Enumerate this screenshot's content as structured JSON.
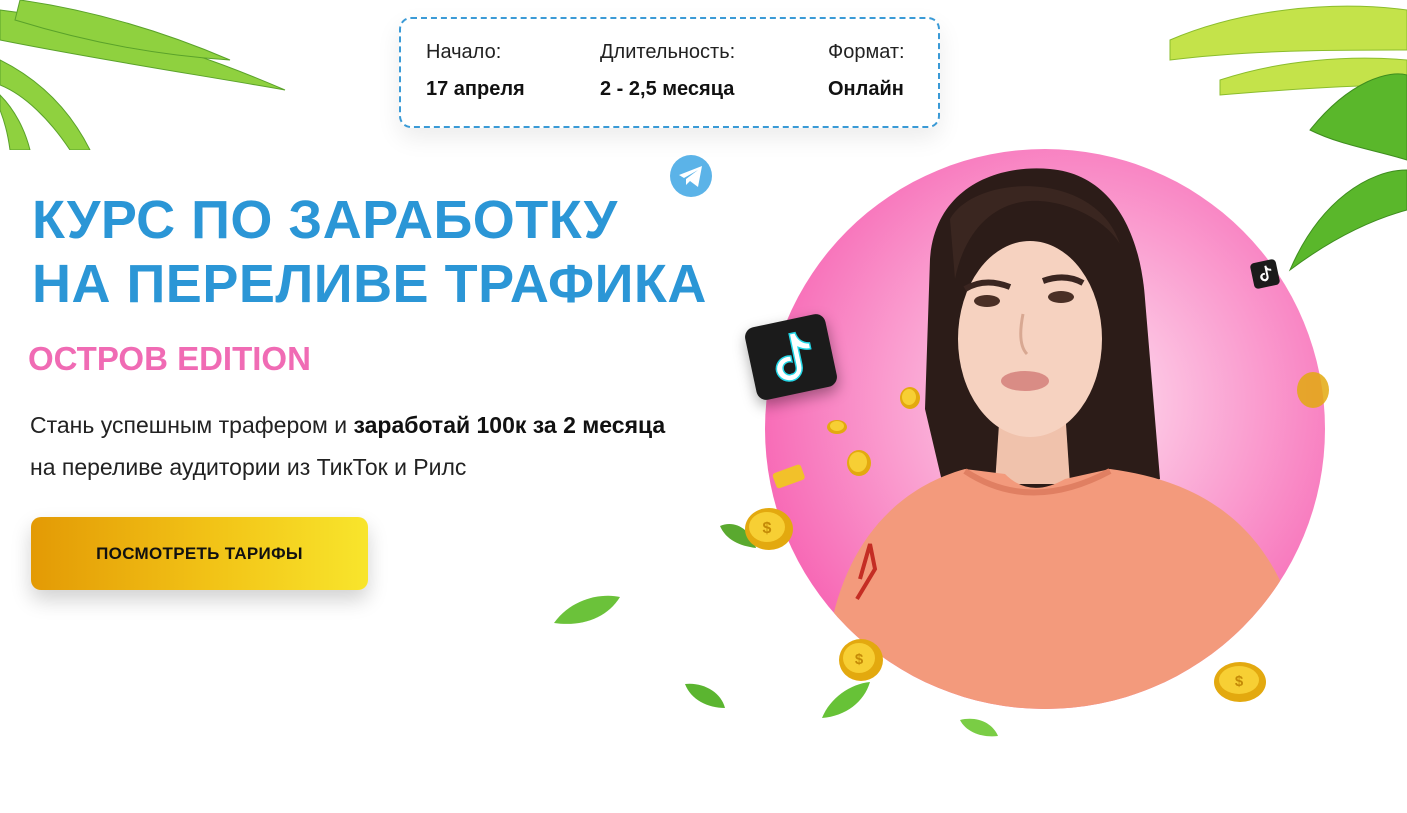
{
  "info": [
    {
      "label": "Начало:",
      "value": "17 апреля"
    },
    {
      "label": "Длительность:",
      "value": "2 - 2,5 месяца"
    },
    {
      "label": "Формат:",
      "value": "Онлайн"
    }
  ],
  "hero": {
    "title_line1": "КУРС ПО ЗАРАБОТКУ",
    "title_line2": "НА ПЕРЕЛИВЕ ТРАФИКА",
    "subtitle": "ОСТРОВ EDITION",
    "desc_part1": "Стань успешным трафером и ",
    "desc_bold": "заработай 100к за 2 месяца",
    "desc_part2": " на переливе аудитории из ТикТок и Рилс",
    "cta_label": "ПОСМОТРЕТЬ ТАРИФЫ"
  },
  "colors": {
    "title": "#2b96d6",
    "subtitle": "#f06bb4",
    "photo_bg": "#f766b4",
    "cta_start": "#e39a05",
    "cta_end": "#f8e52c",
    "card_border": "#3a9ad6"
  },
  "icons": [
    "palm-leaf-icon",
    "telegram-icon",
    "tiktok-icon",
    "coin-icon",
    "leaf-icon"
  ]
}
